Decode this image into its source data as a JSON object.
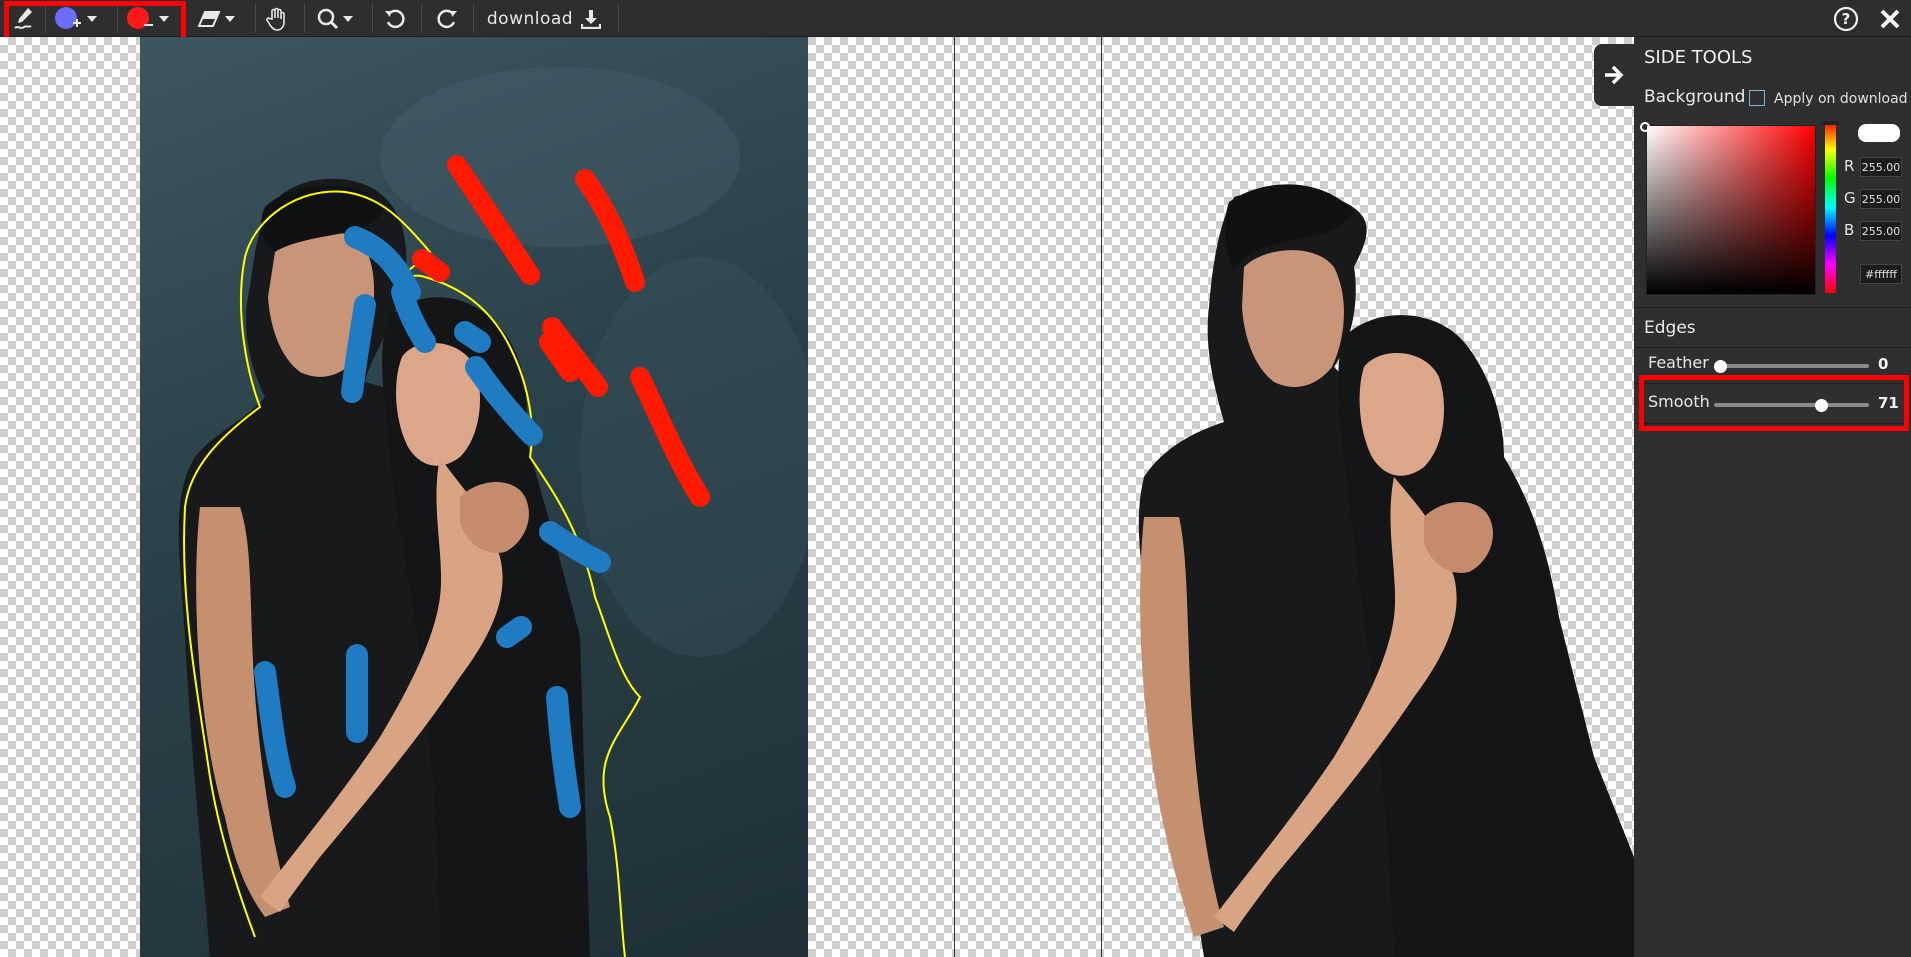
{
  "toolbar": {
    "download_label": "download",
    "tools": [
      {
        "name": "mark-tool",
        "icon": "pen-mark-icon"
      },
      {
        "name": "keep-brush",
        "icon": "plus-brush-icon",
        "color": "#6c6cff"
      },
      {
        "name": "remove-brush",
        "icon": "minus-brush-icon",
        "color": "#ff1a1a"
      },
      {
        "name": "eraser",
        "icon": "eraser-icon"
      },
      {
        "name": "pan",
        "icon": "hand-icon"
      },
      {
        "name": "zoom",
        "icon": "magnifier-icon"
      },
      {
        "name": "undo",
        "icon": "undo-icon"
      },
      {
        "name": "redo",
        "icon": "redo-icon"
      }
    ],
    "help_icon": "help-icon",
    "close_icon": "close-icon",
    "highlight_color": "#ff0000"
  },
  "side_panel": {
    "title": "SIDE TOOLS",
    "background_label": "Background",
    "apply_label": "Apply on download",
    "rgb": {
      "r_label": "R",
      "r_value": "255.00",
      "g_label": "G",
      "g_value": "255.00",
      "b_label": "B",
      "b_value": "255.00"
    },
    "hex_value": "#ffffff",
    "edges_label": "Edges",
    "feather": {
      "label": "Feather",
      "value": "0",
      "fraction": 0.0
    },
    "smooth": {
      "label": "Smooth",
      "value": "71",
      "fraction": 0.71
    }
  },
  "canvas": {
    "keep_stroke_color": "#1f7bc2",
    "remove_stroke_color": "#ff1a00",
    "outline_color": "#ffff00"
  }
}
